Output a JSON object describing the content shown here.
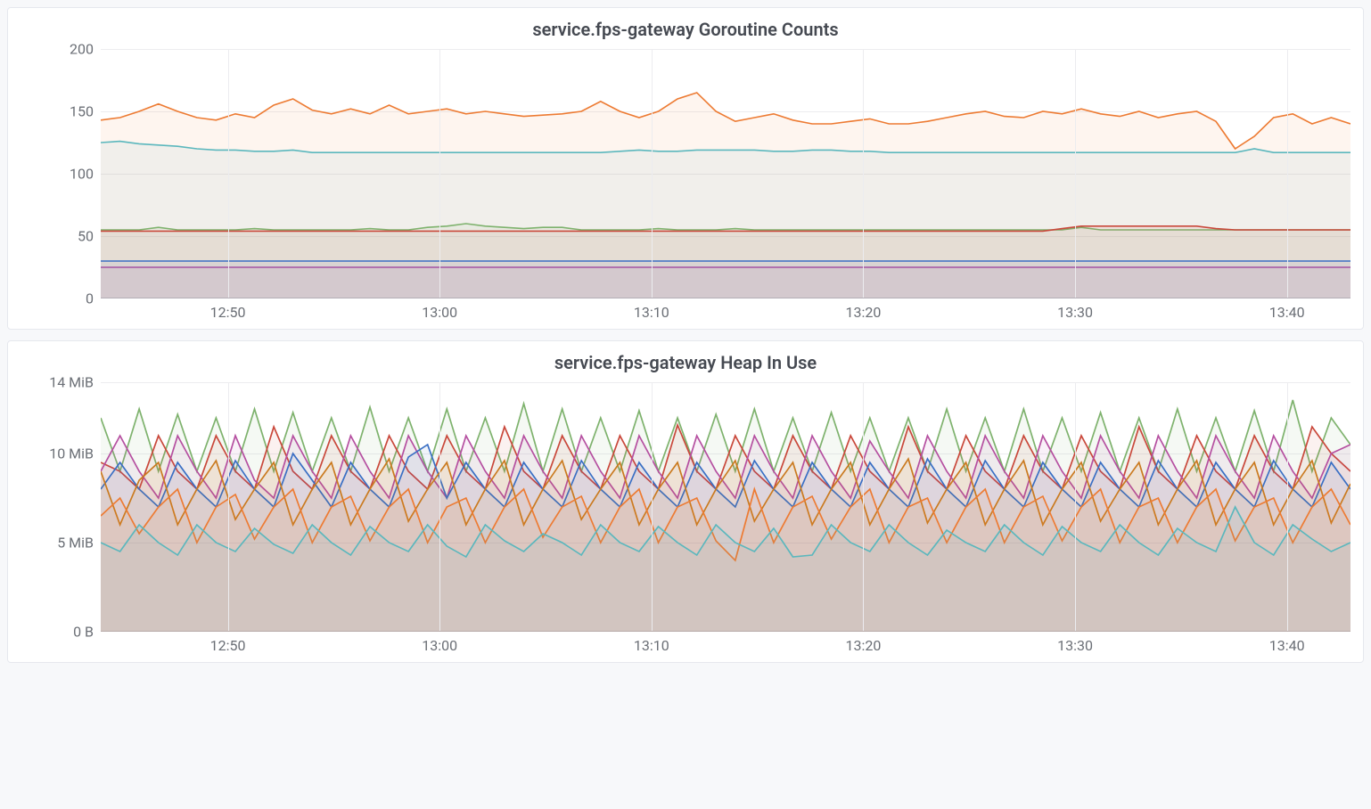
{
  "chart_data": [
    {
      "type": "line",
      "title": "service.fps-gateway Goroutine Counts",
      "ylabel": "",
      "xlabel": "",
      "ylim": [
        0,
        200
      ],
      "yticks": [
        0,
        50,
        100,
        150,
        200
      ],
      "xticks": [
        "12:50",
        "13:00",
        "13:10",
        "13:20",
        "13:30",
        "13:40"
      ],
      "x_range_minutes": [
        44,
        103
      ],
      "series": [
        {
          "name": "orange",
          "color": "#ed7b33",
          "values": [
            143,
            145,
            150,
            156,
            150,
            145,
            143,
            148,
            145,
            155,
            160,
            151,
            148,
            152,
            148,
            155,
            148,
            150,
            152,
            148,
            150,
            148,
            146,
            147,
            148,
            150,
            158,
            150,
            145,
            150,
            160,
            165,
            150,
            142,
            145,
            148,
            143,
            140,
            140,
            142,
            144,
            140,
            140,
            142,
            145,
            148,
            150,
            146,
            145,
            150,
            148,
            152,
            148,
            146,
            150,
            145,
            148,
            150,
            142,
            120,
            130,
            145,
            148,
            140,
            145,
            140
          ]
        },
        {
          "name": "teal",
          "color": "#5bb7bd",
          "values": [
            125,
            126,
            124,
            123,
            122,
            120,
            119,
            119,
            118,
            118,
            119,
            117,
            117,
            117,
            117,
            117,
            117,
            117,
            117,
            117,
            117,
            117,
            117,
            117,
            117,
            117,
            117,
            118,
            119,
            118,
            118,
            119,
            119,
            119,
            119,
            118,
            118,
            119,
            119,
            118,
            118,
            117,
            117,
            117,
            117,
            117,
            117,
            117,
            117,
            117,
            117,
            117,
            117,
            117,
            117,
            117,
            117,
            117,
            117,
            117,
            120,
            117,
            117,
            117,
            117,
            117
          ]
        },
        {
          "name": "green",
          "color": "#7eb26d",
          "values": [
            55,
            55,
            55,
            57,
            55,
            55,
            55,
            55,
            56,
            55,
            55,
            55,
            55,
            55,
            56,
            55,
            55,
            57,
            58,
            60,
            58,
            57,
            56,
            57,
            57,
            55,
            55,
            55,
            55,
            56,
            55,
            55,
            55,
            56,
            55,
            55,
            55,
            55,
            55,
            55,
            55,
            55,
            55,
            55,
            55,
            55,
            55,
            55,
            55,
            55,
            55,
            57,
            55,
            55,
            55,
            55,
            55,
            55,
            55,
            55,
            55,
            55,
            55,
            55,
            55,
            55
          ]
        },
        {
          "name": "red",
          "color": "#c9483b",
          "values": [
            54,
            54,
            54,
            54,
            54,
            54,
            54,
            54,
            54,
            54,
            54,
            54,
            54,
            54,
            54,
            54,
            54,
            54,
            54,
            54,
            54,
            54,
            54,
            54,
            54,
            54,
            54,
            54,
            54,
            54,
            54,
            54,
            54,
            54,
            54,
            54,
            54,
            54,
            54,
            54,
            54,
            54,
            54,
            54,
            54,
            54,
            54,
            54,
            54,
            54,
            56,
            58,
            58,
            58,
            58,
            58,
            58,
            58,
            56,
            55,
            55,
            55,
            55,
            55,
            55,
            55
          ]
        },
        {
          "name": "blue",
          "color": "#3a6fc4",
          "values": [
            30,
            30,
            30,
            30,
            30,
            30,
            30,
            30,
            30,
            30,
            30,
            30,
            30,
            30,
            30,
            30,
            30,
            30,
            30,
            30,
            30,
            30,
            30,
            30,
            30,
            30,
            30,
            30,
            30,
            30,
            30,
            30,
            30,
            30,
            30,
            30,
            30,
            30,
            30,
            30,
            30,
            30,
            30,
            30,
            30,
            30,
            30,
            30,
            30,
            30,
            30,
            30,
            30,
            30,
            30,
            30,
            30,
            30,
            30,
            30,
            30,
            30,
            30,
            30,
            30,
            30
          ]
        },
        {
          "name": "purple",
          "color": "#a352a3",
          "values": [
            25,
            25,
            25,
            25,
            25,
            25,
            25,
            25,
            25,
            25,
            25,
            25,
            25,
            25,
            25,
            25,
            25,
            25,
            25,
            25,
            25,
            25,
            25,
            25,
            25,
            25,
            25,
            25,
            25,
            25,
            25,
            25,
            25,
            25,
            25,
            25,
            25,
            25,
            25,
            25,
            25,
            25,
            25,
            25,
            25,
            25,
            25,
            25,
            25,
            25,
            25,
            25,
            25,
            25,
            25,
            25,
            25,
            25,
            25,
            25,
            25,
            25,
            25,
            25,
            25,
            25
          ]
        }
      ],
      "layout": {
        "y_label_width": 90,
        "inner_height": 280
      }
    },
    {
      "type": "line",
      "title": "service.fps-gateway Heap In Use",
      "ylabel": "",
      "xlabel": "",
      "ylim": [
        0,
        14
      ],
      "yticks_labels": [
        "0 B",
        "5 MiB",
        "10 MiB",
        "14 MiB"
      ],
      "yticks": [
        0,
        5,
        10,
        14
      ],
      "xticks": [
        "12:50",
        "13:00",
        "13:10",
        "13:20",
        "13:30",
        "13:40"
      ],
      "x_range_minutes": [
        44,
        103
      ],
      "series": [
        {
          "name": "green",
          "color": "#7eb26d",
          "values": [
            12,
            9,
            12.5,
            9,
            12.2,
            9,
            12,
            9,
            12.5,
            9,
            12.3,
            9,
            12,
            9,
            12.6,
            9,
            12,
            9,
            12.5,
            9,
            12,
            9,
            12.8,
            9,
            12.5,
            9,
            12,
            9,
            12.4,
            9,
            12,
            9,
            12.2,
            9,
            12.5,
            9,
            12,
            9,
            12.3,
            9,
            12,
            9,
            12,
            9,
            12.5,
            9,
            12,
            9,
            12.5,
            9,
            12,
            9,
            12.3,
            9,
            12,
            9,
            12.5,
            9,
            12,
            9,
            12.4,
            9,
            13,
            9,
            12,
            10.5
          ]
        },
        {
          "name": "red",
          "color": "#c9483b",
          "values": [
            9.5,
            9,
            8,
            11,
            9,
            8,
            11,
            9,
            8,
            11.5,
            9,
            8,
            11,
            9,
            8,
            11,
            9,
            8,
            11,
            9,
            8,
            11.5,
            9,
            8,
            11,
            9,
            8,
            11,
            9,
            8,
            11.6,
            9,
            8,
            11,
            9,
            8,
            11,
            9,
            8,
            11,
            9,
            8,
            11.5,
            9,
            8,
            11,
            9,
            8,
            11,
            9,
            8,
            11,
            9,
            8,
            11.5,
            9,
            8,
            11,
            9,
            8,
            11,
            9,
            8,
            11.5,
            10,
            9
          ]
        },
        {
          "name": "magenta",
          "color": "#b54fa0",
          "values": [
            9,
            11,
            9,
            7.5,
            11,
            9,
            7.5,
            11,
            8.5,
            7.5,
            11,
            9,
            7.5,
            11,
            9,
            7.5,
            11,
            9,
            7.5,
            11,
            9,
            7.5,
            11,
            9,
            7.5,
            11,
            9,
            7.5,
            11,
            9,
            7.5,
            11,
            9,
            7.5,
            11,
            9,
            7.5,
            11,
            9,
            7.5,
            10.7,
            9,
            7.5,
            11,
            9,
            7.5,
            11,
            9,
            7.5,
            11,
            9,
            7.5,
            11,
            9,
            7.5,
            11,
            9,
            7.5,
            11,
            9,
            7.5,
            11,
            9,
            7.5,
            10,
            10.5
          ]
        },
        {
          "name": "blue",
          "color": "#3a6fc4",
          "values": [
            8,
            9.5,
            8,
            7,
            9.5,
            8,
            7,
            9.6,
            8,
            7,
            10,
            8.5,
            7,
            9.5,
            8,
            7,
            9.8,
            10.5,
            7.5,
            9.5,
            8,
            7,
            9.5,
            8,
            7,
            9.6,
            8,
            7,
            9.5,
            8,
            7,
            9.5,
            8,
            7,
            9.6,
            8,
            7,
            9.5,
            8,
            7,
            9.5,
            8,
            7,
            9.7,
            8,
            7,
            9.6,
            8,
            7,
            9.5,
            8,
            7,
            9.5,
            8,
            7,
            9.6,
            8,
            7,
            9.5,
            8,
            7,
            9.6,
            8,
            7,
            9.5,
            8
          ]
        },
        {
          "name": "darkorange",
          "color": "#ca7a1f",
          "values": [
            9,
            6,
            8.5,
            9.5,
            6,
            8,
            9.6,
            6.3,
            8,
            9.5,
            6,
            8,
            9.5,
            6,
            8,
            9.7,
            6.2,
            8,
            9.5,
            6,
            8,
            9.6,
            6,
            8,
            9.6,
            6.3,
            8,
            9.5,
            6,
            8,
            9.5,
            6,
            8,
            9.6,
            6.2,
            8,
            9.5,
            6,
            8,
            9.5,
            6,
            8,
            9.7,
            6.1,
            8,
            9.5,
            6,
            8,
            9.6,
            6,
            8,
            9.5,
            6.2,
            8,
            9.5,
            6,
            8,
            9.6,
            6,
            8,
            9.5,
            6,
            8,
            9.6,
            6.1,
            8.3
          ]
        },
        {
          "name": "brtorange",
          "color": "#ed7b33",
          "values": [
            6.5,
            7.5,
            5.5,
            7,
            8,
            5,
            7,
            7.7,
            5.2,
            7,
            8,
            5,
            7,
            7.6,
            5.1,
            7,
            8,
            5,
            7,
            7.5,
            5,
            7,
            8,
            5.3,
            7,
            7.6,
            5,
            7,
            8,
            5,
            7,
            7.5,
            5.1,
            4,
            8,
            5,
            7,
            7.6,
            5.2,
            7,
            8,
            5,
            7,
            7.5,
            5,
            7,
            8,
            5,
            7,
            7.6,
            5.1,
            7,
            8,
            5,
            7,
            7.5,
            5,
            7,
            8,
            5.1,
            7,
            7.5,
            5,
            7,
            8,
            6
          ]
        },
        {
          "name": "teal",
          "color": "#5bb7bd",
          "values": [
            5,
            4.5,
            6,
            5,
            4.3,
            6,
            5,
            4.5,
            5.8,
            4.9,
            4.4,
            6,
            5,
            4.3,
            5.9,
            5,
            4.5,
            6,
            4.8,
            4.2,
            6,
            5.1,
            4.5,
            5.5,
            5,
            4.3,
            6,
            5,
            4.5,
            5.9,
            5,
            4.3,
            6,
            5,
            4.5,
            5.8,
            4.2,
            4.3,
            6,
            5,
            4.5,
            6,
            5,
            4.3,
            5.7,
            5,
            4.5,
            6,
            5,
            4.3,
            5.9,
            5,
            4.5,
            6,
            5,
            4.3,
            5.8,
            5,
            4.5,
            7,
            5,
            4.3,
            6,
            5.2,
            4.5,
            5
          ]
        }
      ],
      "layout": {
        "y_label_width": 90,
        "inner_height": 280
      }
    }
  ]
}
